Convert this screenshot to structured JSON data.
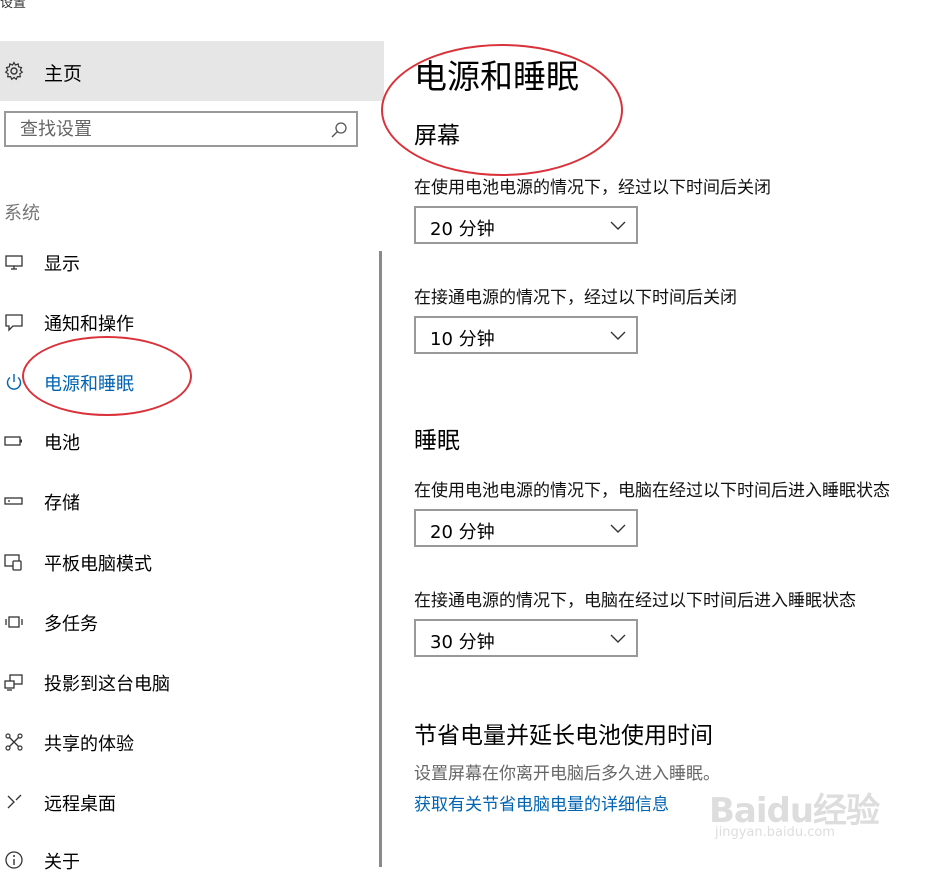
{
  "window": {
    "title": "设置"
  },
  "sidebar": {
    "home_label": "主页",
    "search_placeholder": "查找设置",
    "section_label": "系统",
    "items": [
      {
        "label": "显示",
        "icon": "monitor-icon"
      },
      {
        "label": "通知和操作",
        "icon": "notification-icon"
      },
      {
        "label": "电源和睡眠",
        "icon": "power-icon",
        "active": true
      },
      {
        "label": "电池",
        "icon": "battery-icon"
      },
      {
        "label": "存储",
        "icon": "storage-icon"
      },
      {
        "label": "平板电脑模式",
        "icon": "tablet-mode-icon"
      },
      {
        "label": "多任务",
        "icon": "multitask-icon"
      },
      {
        "label": "投影到这台电脑",
        "icon": "project-icon"
      },
      {
        "label": "共享的体验",
        "icon": "shared-experience-icon"
      },
      {
        "label": "远程桌面",
        "icon": "remote-desktop-icon"
      },
      {
        "label": "关于",
        "icon": "info-icon"
      }
    ]
  },
  "main": {
    "title": "电源和睡眠",
    "screen": {
      "heading": "屏幕",
      "battery_label": "在使用电池电源的情况下，经过以下时间后关闭",
      "battery_value": "20 分钟",
      "plugged_label": "在接通电源的情况下，经过以下时间后关闭",
      "plugged_value": "10 分钟"
    },
    "sleep": {
      "heading": "睡眠",
      "battery_label": "在使用电池电源的情况下，电脑在经过以下时间后进入睡眠状态",
      "battery_value": "20 分钟",
      "plugged_label": "在接通电源的情况下，电脑在经过以下时间后进入睡眠状态",
      "plugged_value": "30 分钟"
    },
    "save_power": {
      "heading": "节省电量并延长电池使用时间",
      "description": "设置屏幕在你离开电脑后多久进入睡眠。",
      "link": "获取有关节省电脑电量的详细信息"
    }
  },
  "watermark": {
    "main": "Baidu经验",
    "sub": "jingyan.baidu.com"
  },
  "colors": {
    "accent": "#0063b1",
    "annotation": "#d9323a",
    "home_bg": "#e6e6e6"
  }
}
